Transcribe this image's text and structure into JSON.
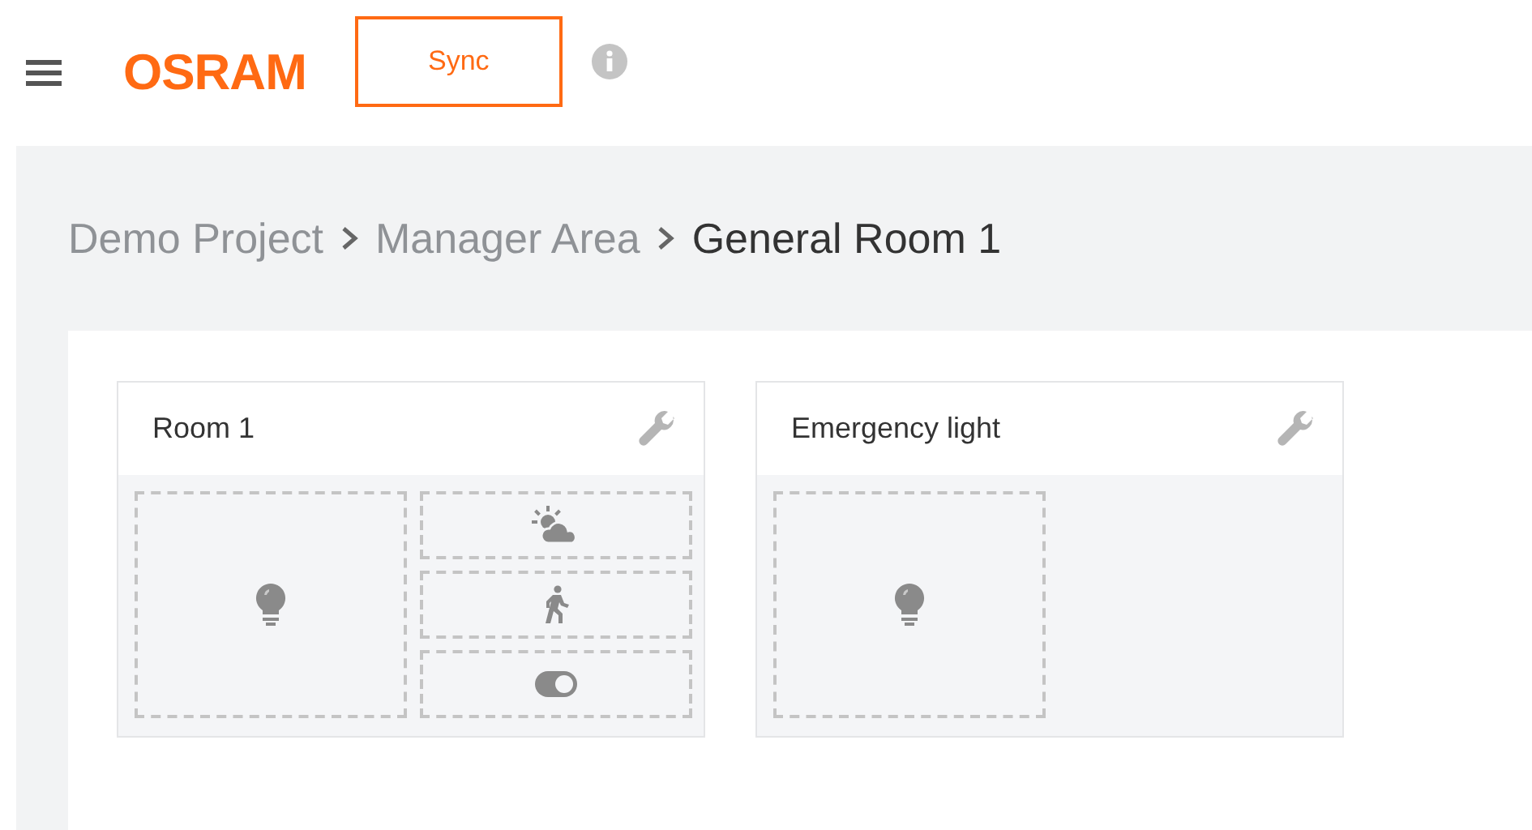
{
  "header": {
    "logo": "OSRAM",
    "sync_button": "Sync"
  },
  "breadcrumb": [
    {
      "label": "Demo Project",
      "selected": false
    },
    {
      "label": "Manager Area",
      "selected": false
    },
    {
      "label": "General Room 1",
      "selected": true
    }
  ],
  "groups": [
    {
      "title": "Room 1",
      "slots": [
        {
          "kind": "light"
        },
        {
          "kind": "daylight"
        },
        {
          "kind": "motion"
        },
        {
          "kind": "switch"
        }
      ]
    },
    {
      "title": "Emergency light",
      "slots": [
        {
          "kind": "light"
        }
      ]
    }
  ]
}
